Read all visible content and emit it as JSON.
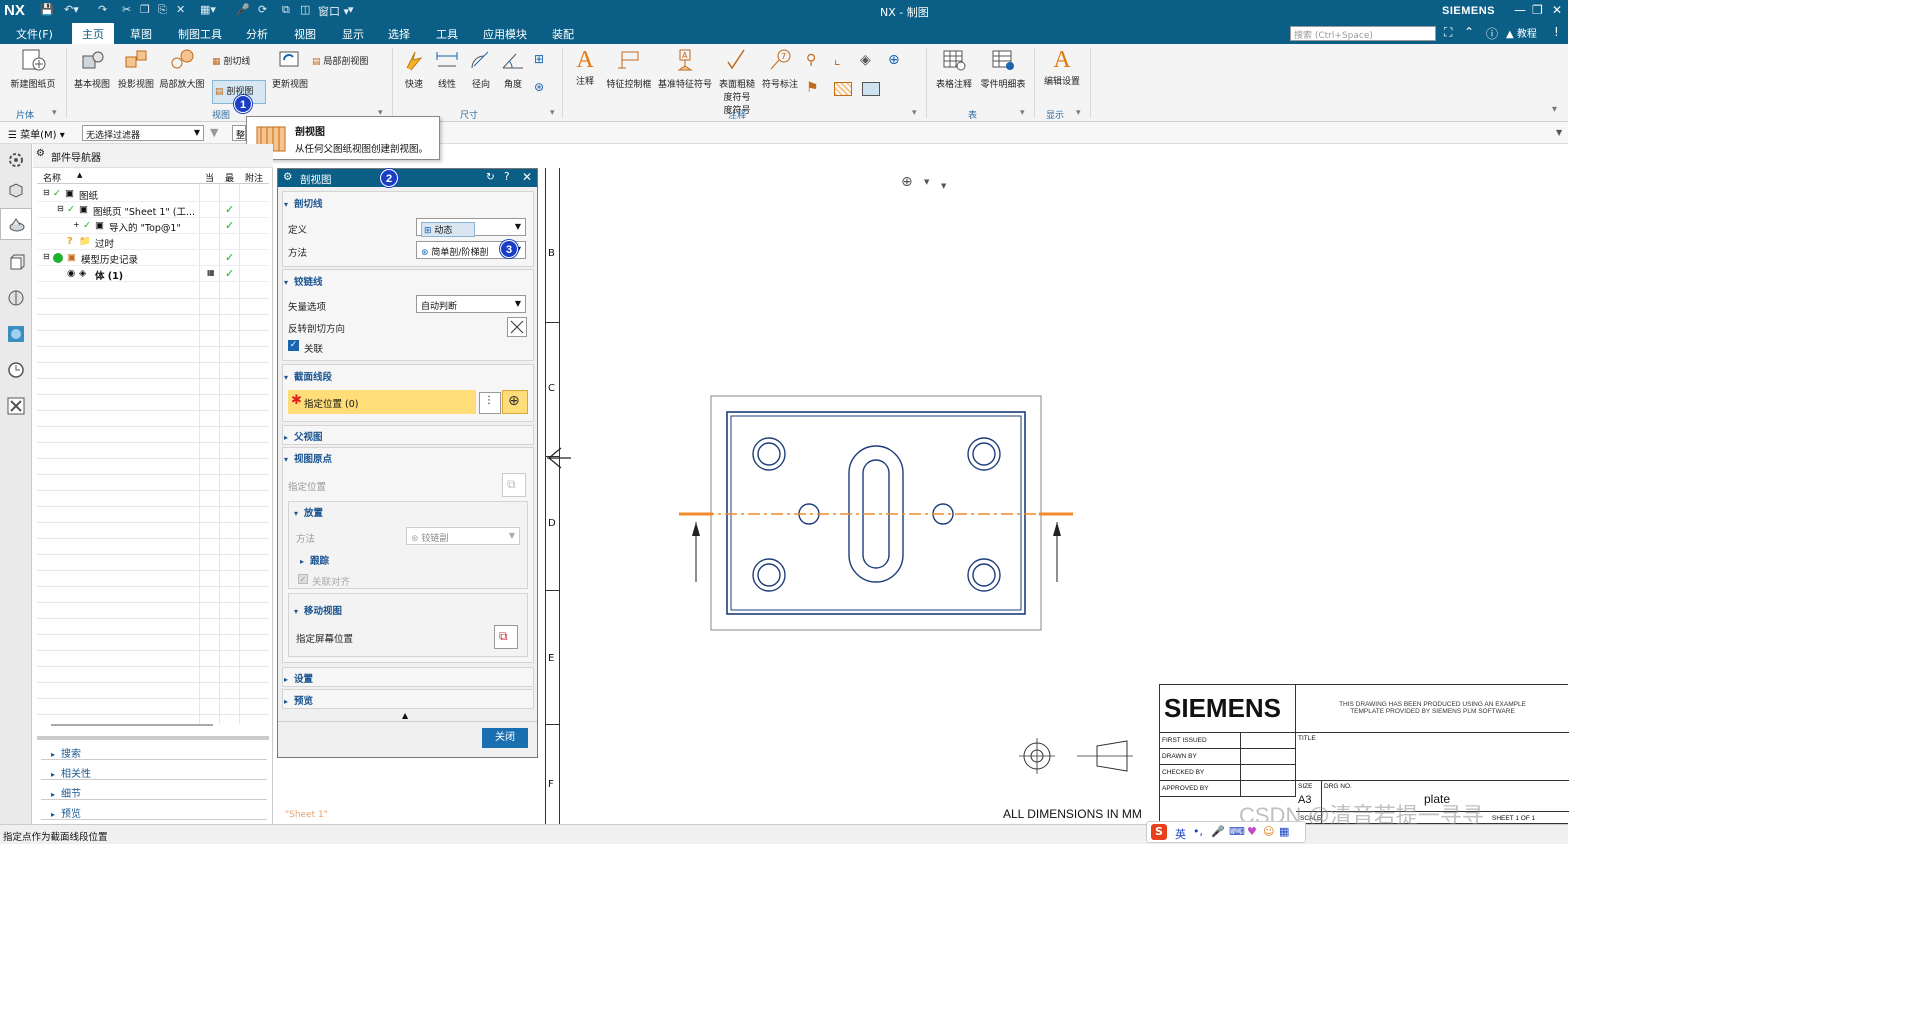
{
  "titlebar": {
    "app_logo": "NX",
    "window_title": "NX - 制图",
    "brand": "SIEMENS",
    "window_menu_label": "窗口"
  },
  "menubar": {
    "items": [
      "文件(F)",
      "主页",
      "草图",
      "制图工具",
      "分析",
      "视图",
      "显示",
      "选择",
      "工具",
      "应用模块",
      "装配"
    ],
    "active": "主页",
    "search_placeholder": "搜索 (Ctrl+Space)",
    "tutorial_label": "教程"
  },
  "ribbon": {
    "groups": {
      "sheet": {
        "label": "片体",
        "buttons": [
          "新建图纸页"
        ]
      },
      "view": {
        "label": "视图",
        "buttons": [
          "基本视图",
          "投影视图",
          "局部放大图",
          "剖切线",
          "剖视图",
          "更新视图",
          "局部剖视图"
        ]
      },
      "dimension": {
        "label": "尺寸",
        "buttons": [
          "快速",
          "线性",
          "径向",
          "角度"
        ]
      },
      "annotation": {
        "label": "注释",
        "buttons": [
          "注释",
          "特征控制框",
          "基准特征符号",
          "表面粗糙度符号",
          "符号标注"
        ]
      },
      "table": {
        "label": "表",
        "buttons": [
          "表格注释",
          "零件明细表"
        ]
      },
      "display": {
        "label": "显示",
        "buttons": [
          "编辑设置"
        ]
      }
    },
    "roughness_line2": "度符号"
  },
  "filterbar": {
    "menu_label": "菜单(M)",
    "filter_value": "无选择过滤器",
    "assembly_value": "整"
  },
  "tooltip": {
    "title": "剖视图",
    "description": "从任何父图纸视图创建剖视图。"
  },
  "navigator": {
    "title": "部件导航器",
    "columns": [
      "名称",
      "当",
      "最",
      "附注"
    ],
    "rows": [
      {
        "label": "图纸",
        "check": true
      },
      {
        "label": "图纸页 \"Sheet 1\" (工...",
        "check": true
      },
      {
        "label": "导入的 \"Top@1\"",
        "check": true
      },
      {
        "label": "过时",
        "check": false
      },
      {
        "label": "模型历史记录",
        "check": true
      },
      {
        "label": "体 (1)",
        "check": true
      }
    ],
    "panels": [
      "搜索",
      "相关性",
      "细节",
      "预览"
    ]
  },
  "dialog": {
    "title": "剖视图",
    "section_line": {
      "header": "剖切线",
      "definition_label": "定义",
      "definition_value": "动态",
      "method_label": "方法",
      "method_value": "简单剖/阶梯剖"
    },
    "hinge_line": {
      "header": "铰链线",
      "vector_label": "矢量选项",
      "vector_value": "自动判断",
      "reverse_label": "反转剖切方向",
      "associative_label": "关联"
    },
    "segment": {
      "header": "截面线段",
      "specify_label": "指定位置 (0)"
    },
    "parent_view": {
      "header": "父视图"
    },
    "view_origin": {
      "header": "视图原点",
      "specify_label": "指定位置",
      "placement_header": "放置",
      "method_label": "方法",
      "method_value": "铰链副",
      "track_header": "跟踪",
      "align_label": "关联对齐",
      "move_header": "移动视图",
      "screen_label": "指定屏幕位置"
    },
    "settings_header": "设置",
    "preview_header": "预览",
    "close_button": "关闭"
  },
  "badges": [
    "1",
    "2",
    "3"
  ],
  "drawing": {
    "zone_labels": [
      "B",
      "C",
      "D",
      "E",
      "F"
    ],
    "sheet_label": "\"Sheet 1\"",
    "title_block": {
      "logo": "SIEMENS",
      "note_line1": "THIS DRAWING HAS BEEN PRODUCED USING AN EXAMPLE",
      "note_line2": "TEMPLATE PROVIDED BY SIEMENS PLM SOFTWARE",
      "rows": [
        "FIRST ISSUED",
        "DRAWN BY",
        "CHECKED BY",
        "APPROVED BY"
      ],
      "title_label": "TITLE",
      "size_label": "SIZE",
      "size_value": "A3",
      "drg_no_label": "DRG NO.",
      "drg_no_value": "plate",
      "scale_label": "SCALE",
      "sheet_label": "SHEET 1 OF 1"
    },
    "dimensions_note": "ALL DIMENSIONS IN MM"
  },
  "status": {
    "message": "指定点作为截面线段位置",
    "ime_lang": "英",
    "watermark": "CSDN @清音若提一寻寻"
  },
  "colors": {
    "accent": "#0b5f86",
    "section_line": "#f08a2a",
    "part_outline": "#1d3d7a",
    "highlight": "#ffde7a",
    "badge": "#1a3fc4"
  }
}
